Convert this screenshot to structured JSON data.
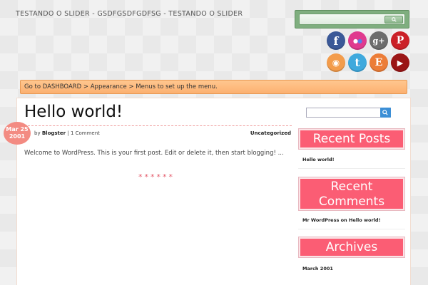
{
  "site": {
    "title": "TESTANDO O SLIDER - GSDFGSDFGDFSG - TESTANDO O SLIDER"
  },
  "header_search": {
    "placeholder": ""
  },
  "social": [
    {
      "name": "facebook-icon",
      "glyph": "f",
      "color": "#3b5998"
    },
    {
      "name": "flickr-icon",
      "glyph": "●●",
      "color": "#e03a8f"
    },
    {
      "name": "google-plus-icon",
      "glyph": "g+",
      "color": "#6d6d6d"
    },
    {
      "name": "pinterest-icon",
      "glyph": "P",
      "color": "#cb2027"
    },
    {
      "name": "rss-icon",
      "glyph": "◉",
      "color": "#f39c4b"
    },
    {
      "name": "twitter-icon",
      "glyph": "t",
      "color": "#3fa9dd"
    },
    {
      "name": "etsy-icon",
      "glyph": "E",
      "color": "#ec7d38"
    },
    {
      "name": "youtube-icon",
      "glyph": "▶",
      "color": "#9b1616"
    }
  ],
  "notice": {
    "text": "Go to DASHBOARD > Appearance > Menus to set up the menu."
  },
  "post": {
    "title": "Hello world!",
    "date_month_day": "Mar 25",
    "date_year": "2001",
    "by_label": "by",
    "author": "Blogster",
    "separator": "|",
    "comments": "1 Comment",
    "category": "Uncategorized",
    "excerpt": "Welcome to WordPress. This is your first post. Edit or delete it, then start blogging! ...",
    "stars": "******"
  },
  "sidebar": {
    "search_placeholder": "",
    "recent_posts_title": "Recent Posts",
    "recent_posts": [
      "Hello world!"
    ],
    "recent_comments_title": "Recent Comments",
    "recent_comment_author": "Mr WordPress",
    "recent_comment_on": "on",
    "recent_comment_post": "Hello world!",
    "archives_title": "Archives",
    "archives": [
      "March 2001"
    ]
  },
  "colors": {
    "accent_pink": "#fb5d74",
    "notice_orange": "#fcb070",
    "search_green": "#7fae7f",
    "date_badge": "#f38b82"
  }
}
